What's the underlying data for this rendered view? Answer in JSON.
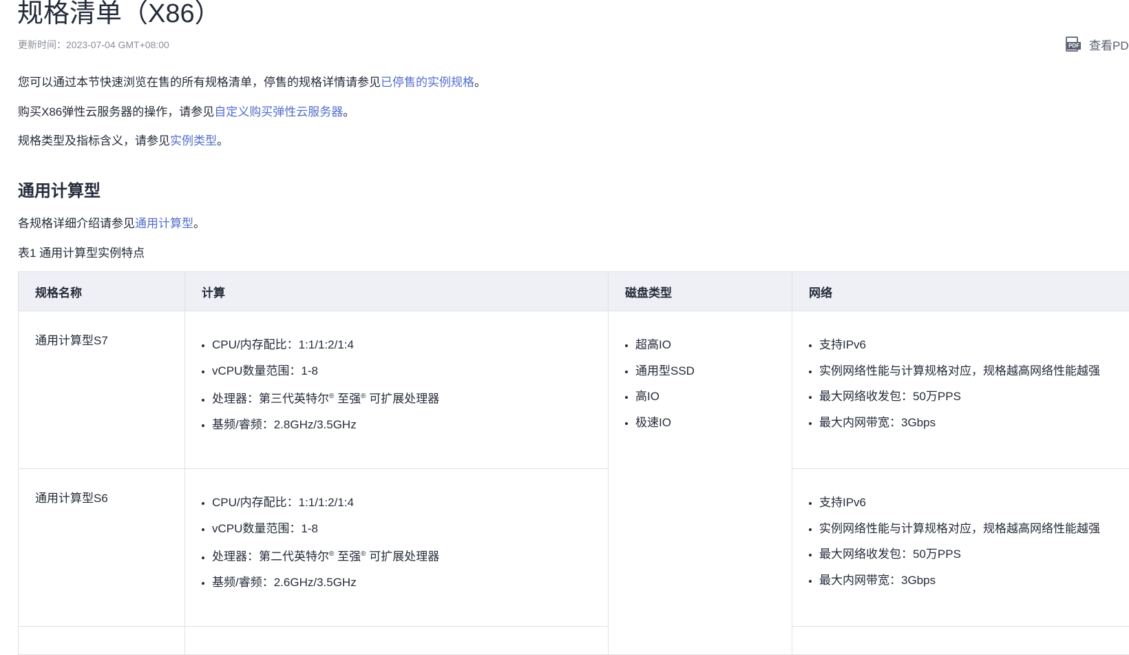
{
  "page": {
    "title": "规格清单（X86）",
    "updated": "更新时间：2023-07-04 GMT+08:00",
    "pdf_label": "查看PDF",
    "pdf_icon": "pdf-icon"
  },
  "intro": [
    {
      "before": "您可以通过本节快速浏览在售的所有规格清单，停售的规格详情请参见",
      "link": "已停售的实例规格",
      "after": "。"
    },
    {
      "before": "购买X86弹性云服务器的操作，请参见",
      "link": "自定义购买弹性云服务器",
      "after": "。"
    },
    {
      "before": "规格类型及指标含义，请参见",
      "link": "实例类型",
      "after": "。"
    }
  ],
  "section": {
    "heading": "通用计算型",
    "desc_before": "各规格详细介绍请参见",
    "desc_link": "通用计算型",
    "desc_after": "。",
    "caption": "表1 通用计算型实例特点"
  },
  "table": {
    "headers": [
      "规格名称",
      "计算",
      "磁盘类型",
      "网络"
    ],
    "disk": [
      "超高IO",
      "通用型SSD",
      "高IO",
      "极速IO"
    ],
    "rows": [
      {
        "name": "通用计算型S7",
        "compute": [
          "CPU/内存配比：1:1/1:2/1:4",
          "vCPU数量范围：1-8",
          "处理器：第三代英特尔® 至强® 可扩展处理器",
          "基频/睿频：2.8GHz/3.5GHz"
        ],
        "network": [
          "支持IPv6",
          "实例网络性能与计算规格对应，规格越高网络性能越强",
          "最大网络收发包：50万PPS",
          "最大内网带宽：3Gbps"
        ]
      },
      {
        "name": "通用计算型S6",
        "compute": [
          "CPU/内存配比：1:1/1:2/1:4",
          "vCPU数量范围：1-8",
          "处理器：第二代英特尔® 至强® 可扩展处理器",
          "基频/睿频：2.6GHz/3.5GHz"
        ],
        "network": [
          "支持IPv6",
          "实例网络性能与计算规格对应，规格越高网络性能越强",
          "最大网络收发包：50万PPS",
          "最大内网带宽：3Gbps"
        ]
      }
    ]
  },
  "colors": {
    "link": "#526ecc",
    "header_bg": "#eef0f5",
    "text": "#252b3a"
  }
}
